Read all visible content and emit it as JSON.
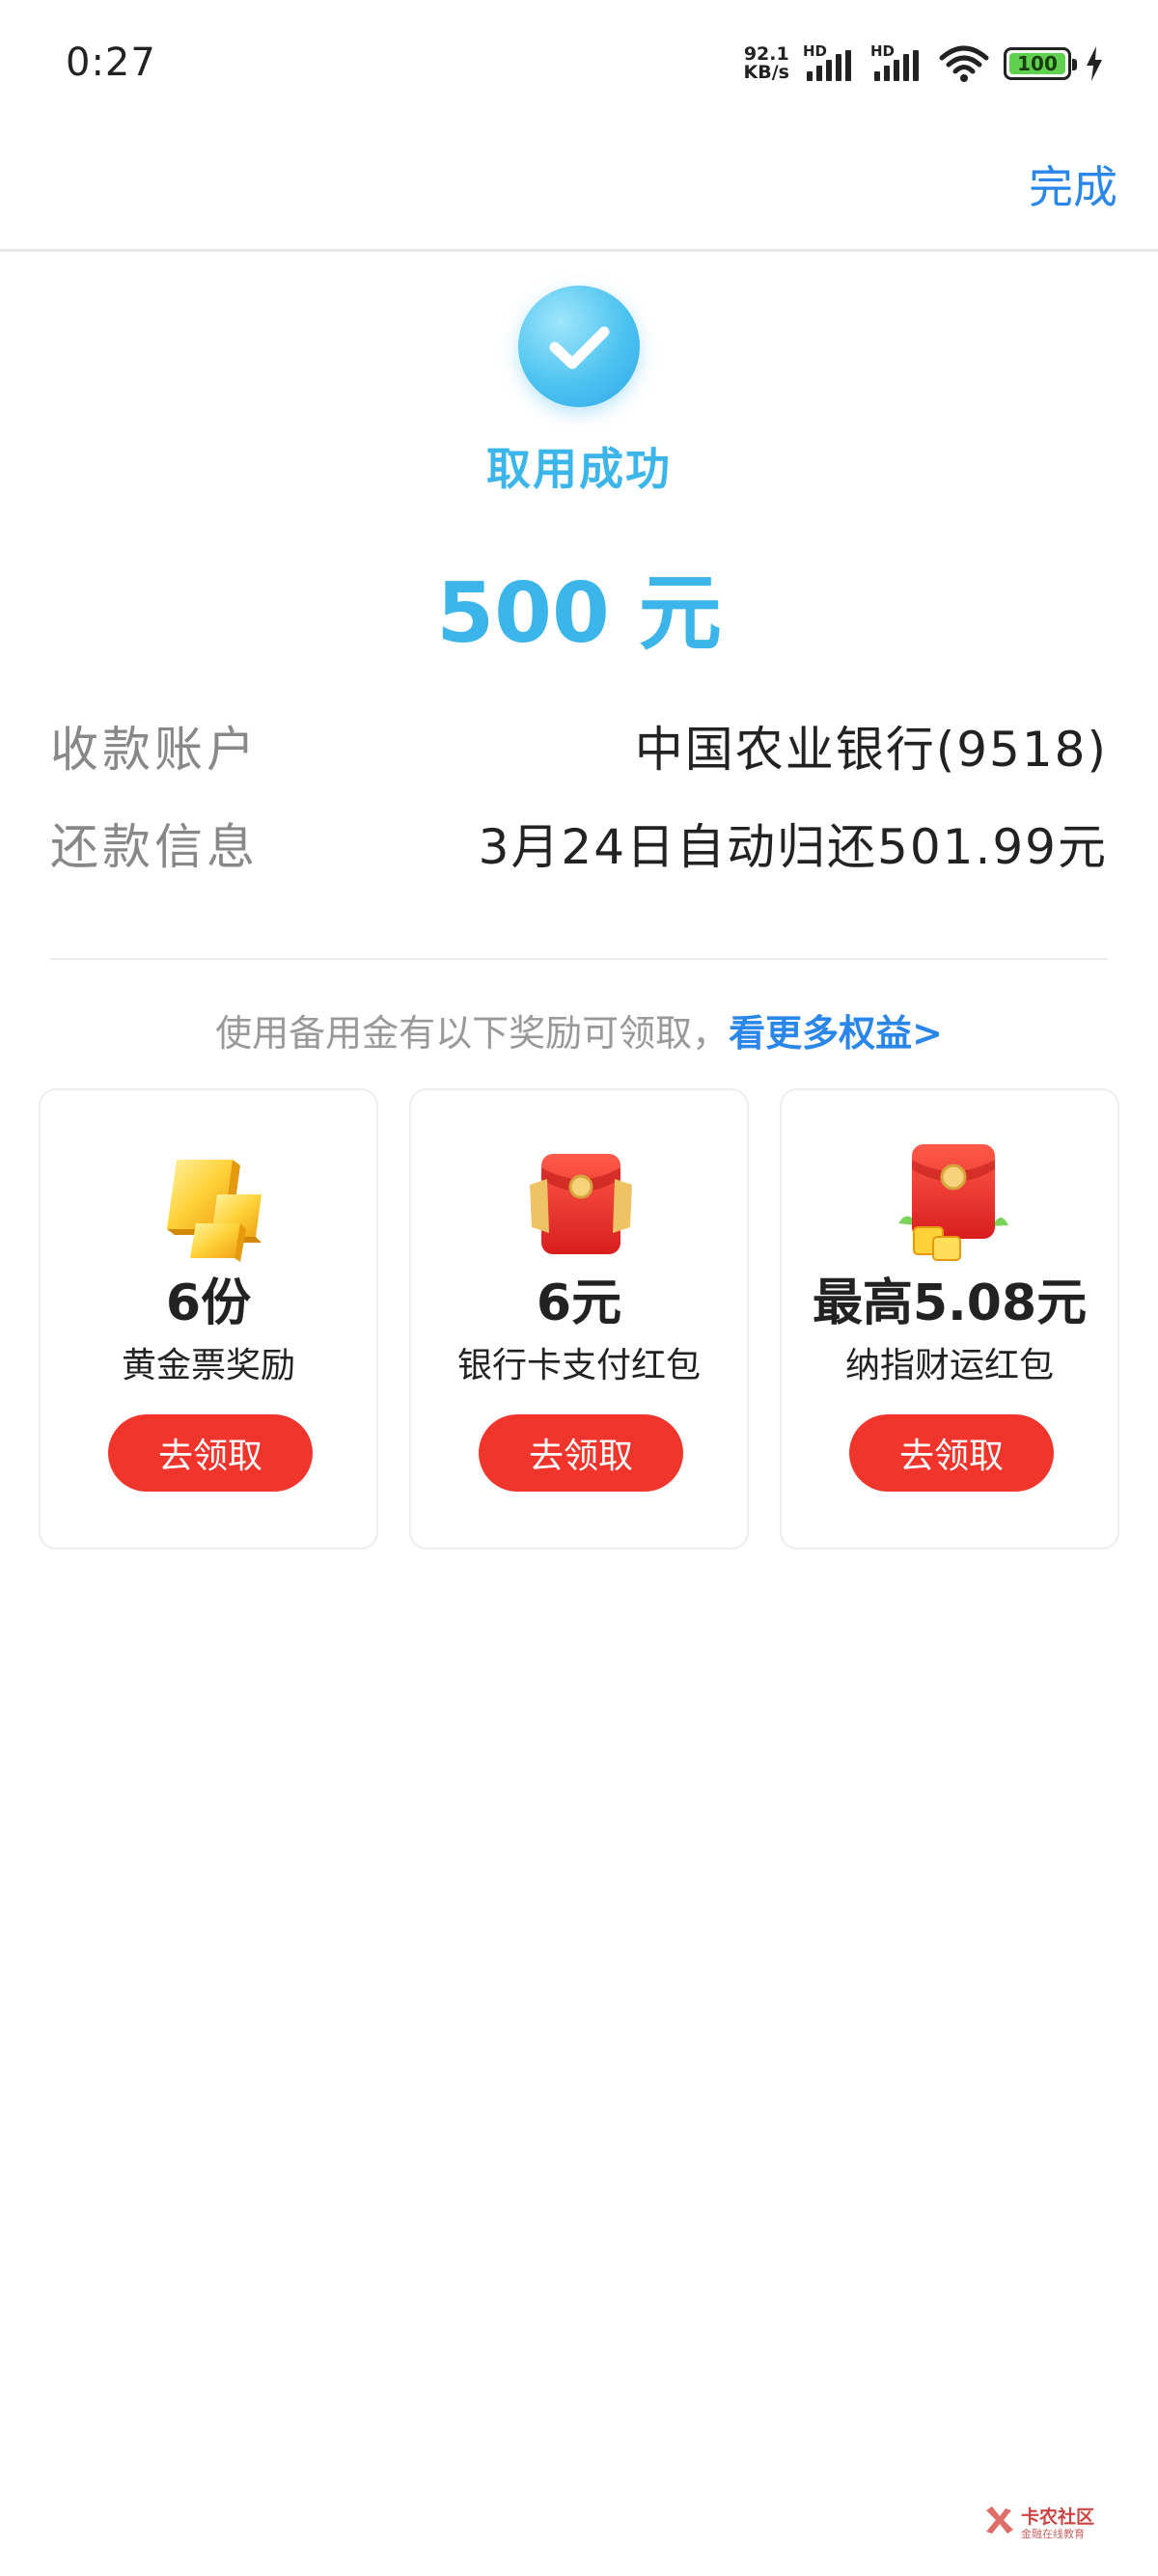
{
  "status_bar": {
    "time": "0:27",
    "net_speed_value": "92.1",
    "net_speed_unit": "KB/s",
    "sim1_label": "HD",
    "sim2_label": "HD",
    "battery_level": "100",
    "icons": [
      "signal-icon",
      "wifi-icon",
      "battery-icon",
      "charging-icon"
    ]
  },
  "header": {
    "done_label": "完成"
  },
  "result": {
    "status_text": "取用成功",
    "amount": "500 元",
    "icon": "check-circle-icon",
    "accent_color": "#3bb5ea"
  },
  "details": [
    {
      "label": "收款账户",
      "value": "中国农业银行(9518)"
    },
    {
      "label": "还款信息",
      "value": "3月24日自动归还501.99元"
    }
  ],
  "rewards": {
    "tip_text": "使用备用金有以下奖励可领取，",
    "more_link": "看更多权益>",
    "cards": [
      {
        "icon": "gold-bars-icon",
        "value": "6份",
        "desc": "黄金票奖励",
        "button": "去领取"
      },
      {
        "icon": "red-envelope-icon",
        "value": "6元",
        "desc": "银行卡支付红包",
        "button": "去领取"
      },
      {
        "icon": "red-envelope-gold-icon",
        "value": "最高5.08元",
        "desc": "纳指财运红包",
        "button": "去领取"
      }
    ],
    "button_color": "#f2352c"
  },
  "watermark": {
    "name": "卡农社区",
    "sub": "金融在线教育"
  }
}
